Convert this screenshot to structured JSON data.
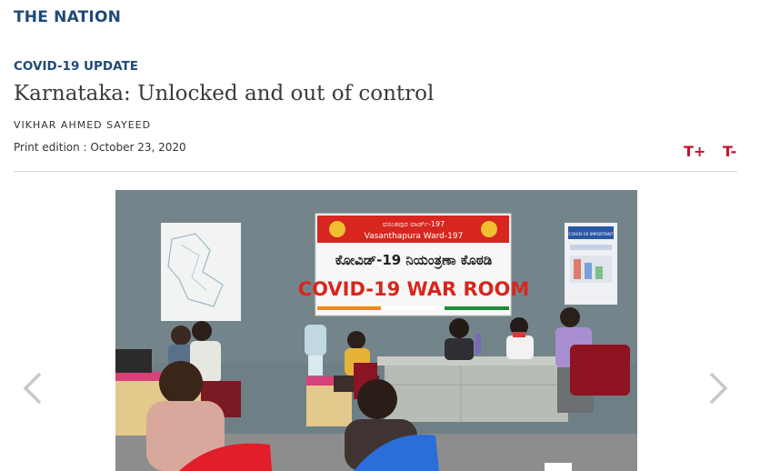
{
  "section": "THE NATION",
  "article": {
    "kicker": "COVID-19 UPDATE",
    "headline": "Karnataka: Unlocked and out of control",
    "author": "VIKHAR AHMED SAYEED",
    "edition": "Print edition : October 23, 2020"
  },
  "text_size": {
    "increase_label": "T+",
    "decrease_label": "T-"
  },
  "photo": {
    "banner_kannada_top": "ವಸಂತಪುರ ವಾರ್ಡ್-197",
    "banner_english_top": "Vasanthapura Ward-197",
    "banner_kannada_main": "ಕೋವಿಡ್-19 ನಿಯಂತ್ರಣಾ ಕೊಠಡಿ",
    "banner_english_main": "COVID-19 WAR ROOM",
    "poster_text": "COVID-19 IMPORTANT"
  },
  "icons": {
    "prev": "chevron-left-icon",
    "next": "chevron-right-icon"
  },
  "colors": {
    "brand_blue": "#1f4a7a",
    "accent_red": "#c8102e",
    "banner_red": "#d7261f"
  }
}
